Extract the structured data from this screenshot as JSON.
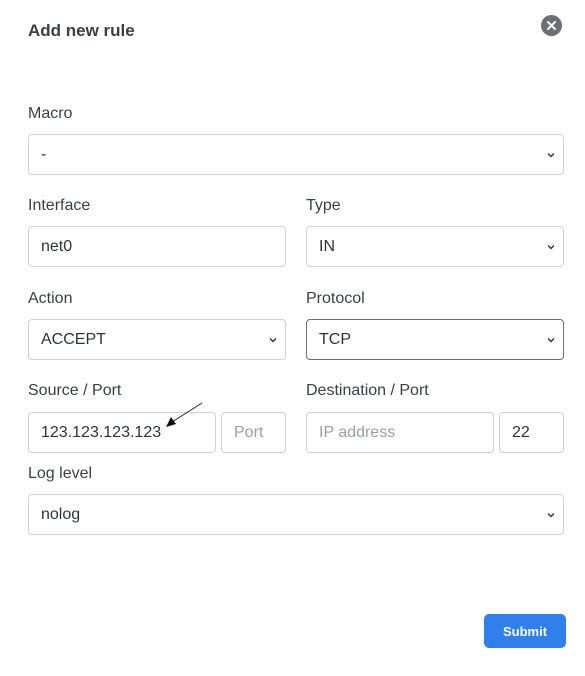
{
  "dialog": {
    "title": "Add new rule",
    "submit_label": "Submit"
  },
  "form": {
    "macro": {
      "label": "Macro",
      "value": "-"
    },
    "interface": {
      "label": "Interface",
      "value": "net0"
    },
    "type": {
      "label": "Type",
      "value": "IN"
    },
    "action": {
      "label": "Action",
      "value": "ACCEPT"
    },
    "protocol": {
      "label": "Protocol",
      "value": "TCP"
    },
    "source": {
      "label": "Source / Port",
      "address_value": "123.123.123.123",
      "port_placeholder": "Port"
    },
    "destination": {
      "label": "Destination / Port",
      "address_placeholder": "IP address",
      "port_value": "22"
    },
    "log_level": {
      "label": "Log level",
      "value": "nolog"
    }
  },
  "colors": {
    "accent": "#2f80ed",
    "close_icon_bg": "#6b7078"
  },
  "icons": {
    "close": "close-icon",
    "dropdown": "chevron-down-icon",
    "annotation": "arrow-icon"
  }
}
